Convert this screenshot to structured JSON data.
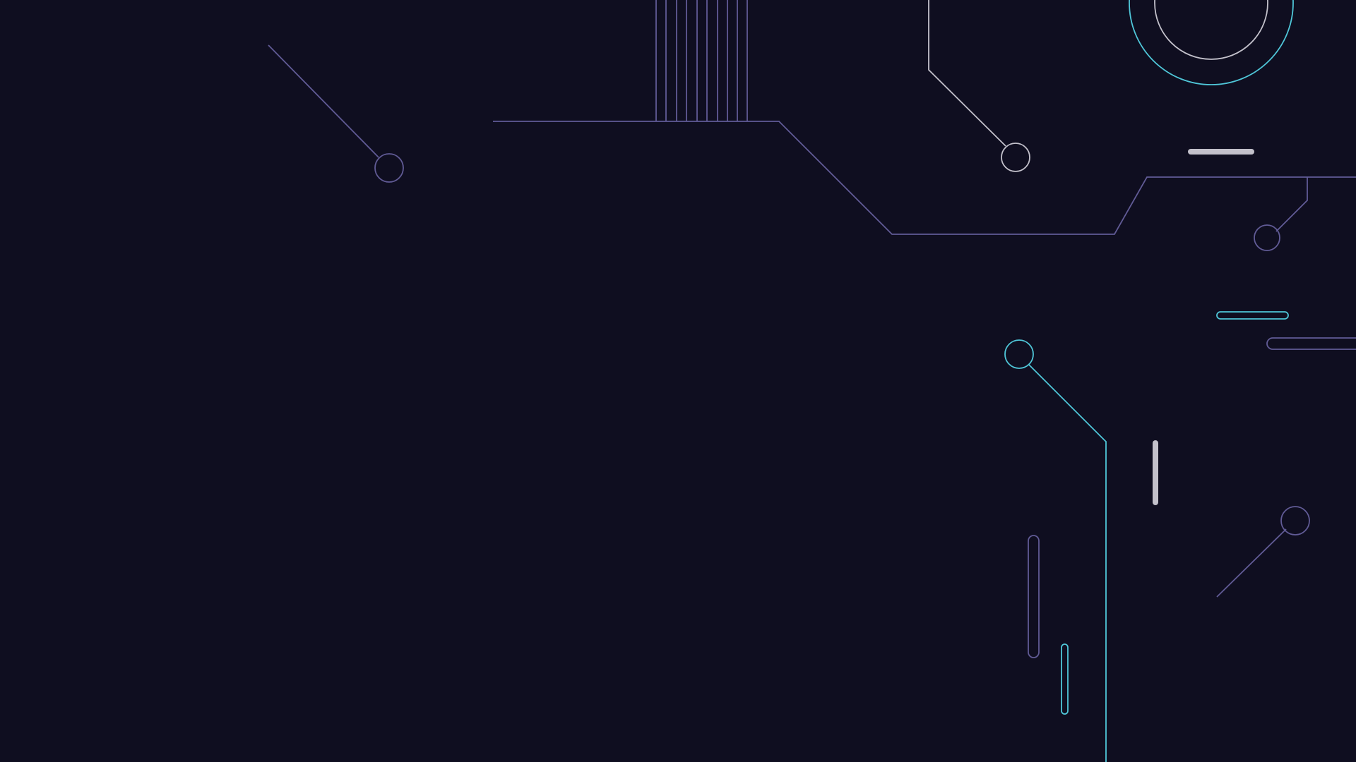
{
  "background": {
    "color": "#0f0e20",
    "description_colors": {
      "purple": "#615b96",
      "cyan": "#4fc6d8",
      "grey": "#c3c1cb"
    }
  }
}
